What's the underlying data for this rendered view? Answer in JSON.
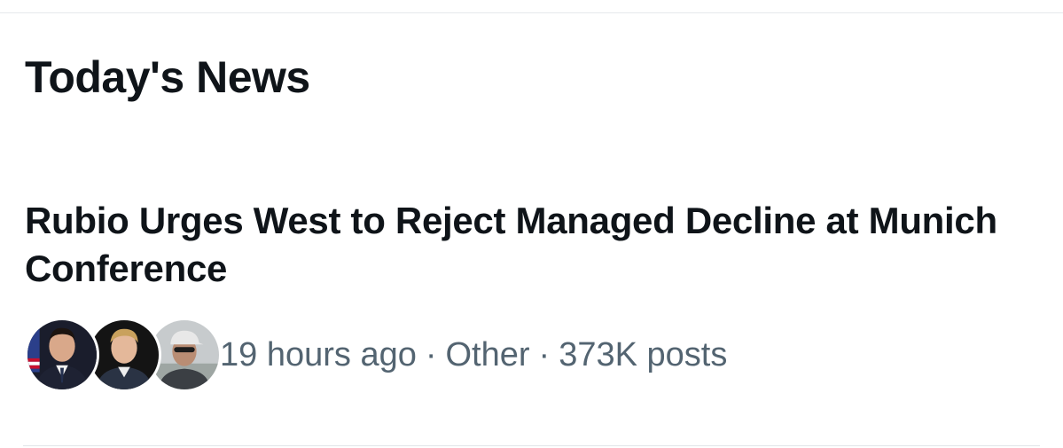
{
  "section": {
    "title": "Today's News"
  },
  "story": {
    "headline": "Rubio Urges West to Reject Managed Decline at Munich Conference",
    "time_ago": "19 hours ago",
    "separator": "·",
    "category": "Other",
    "post_count": "373K posts",
    "avatars": [
      "person-avatar",
      "person-avatar",
      "person-avatar"
    ]
  }
}
